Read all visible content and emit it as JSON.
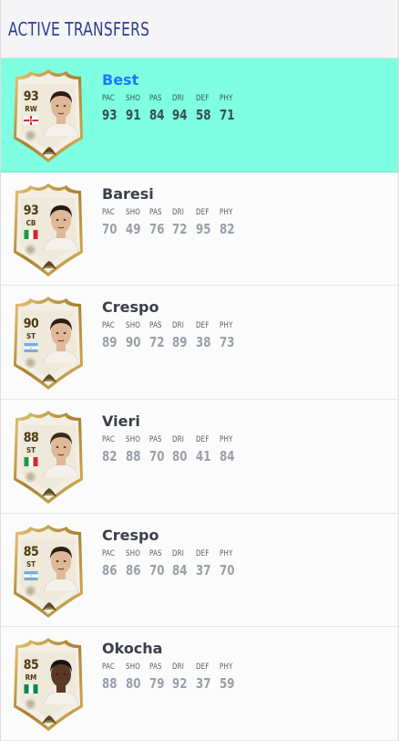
{
  "header": {
    "title": "ACTIVE TRANSFERS"
  },
  "stat_labels": [
    "PAC",
    "SHO",
    "PAS",
    "DRI",
    "DEF",
    "PHY"
  ],
  "colors": {
    "selected_row": "#7effe1",
    "selected_name": "#1a78ff",
    "title": "#2c3f8c",
    "card_gold": "#c9a04a",
    "card_cream": "#f2eee3"
  },
  "transfers": [
    {
      "name": "Best",
      "rating": "93",
      "position": "RW",
      "flag": "northern-ireland-flag",
      "stats": [
        "93",
        "91",
        "84",
        "94",
        "58",
        "71"
      ],
      "selected": true
    },
    {
      "name": "Baresi",
      "rating": "93",
      "position": "CB",
      "flag": "italy-flag",
      "stats": [
        "70",
        "49",
        "76",
        "72",
        "95",
        "82"
      ],
      "selected": false
    },
    {
      "name": "Crespo",
      "rating": "90",
      "position": "ST",
      "flag": "argentina-flag",
      "stats": [
        "89",
        "90",
        "72",
        "89",
        "38",
        "73"
      ],
      "selected": false
    },
    {
      "name": "Vieri",
      "rating": "88",
      "position": "ST",
      "flag": "italy-flag",
      "stats": [
        "82",
        "88",
        "70",
        "80",
        "41",
        "84"
      ],
      "selected": false
    },
    {
      "name": "Crespo",
      "rating": "85",
      "position": "ST",
      "flag": "argentina-flag",
      "stats": [
        "86",
        "86",
        "70",
        "84",
        "37",
        "70"
      ],
      "selected": false
    },
    {
      "name": "Okocha",
      "rating": "85",
      "position": "RM",
      "flag": "nigeria-flag",
      "stats": [
        "88",
        "80",
        "79",
        "92",
        "37",
        "59"
      ],
      "selected": false
    }
  ]
}
